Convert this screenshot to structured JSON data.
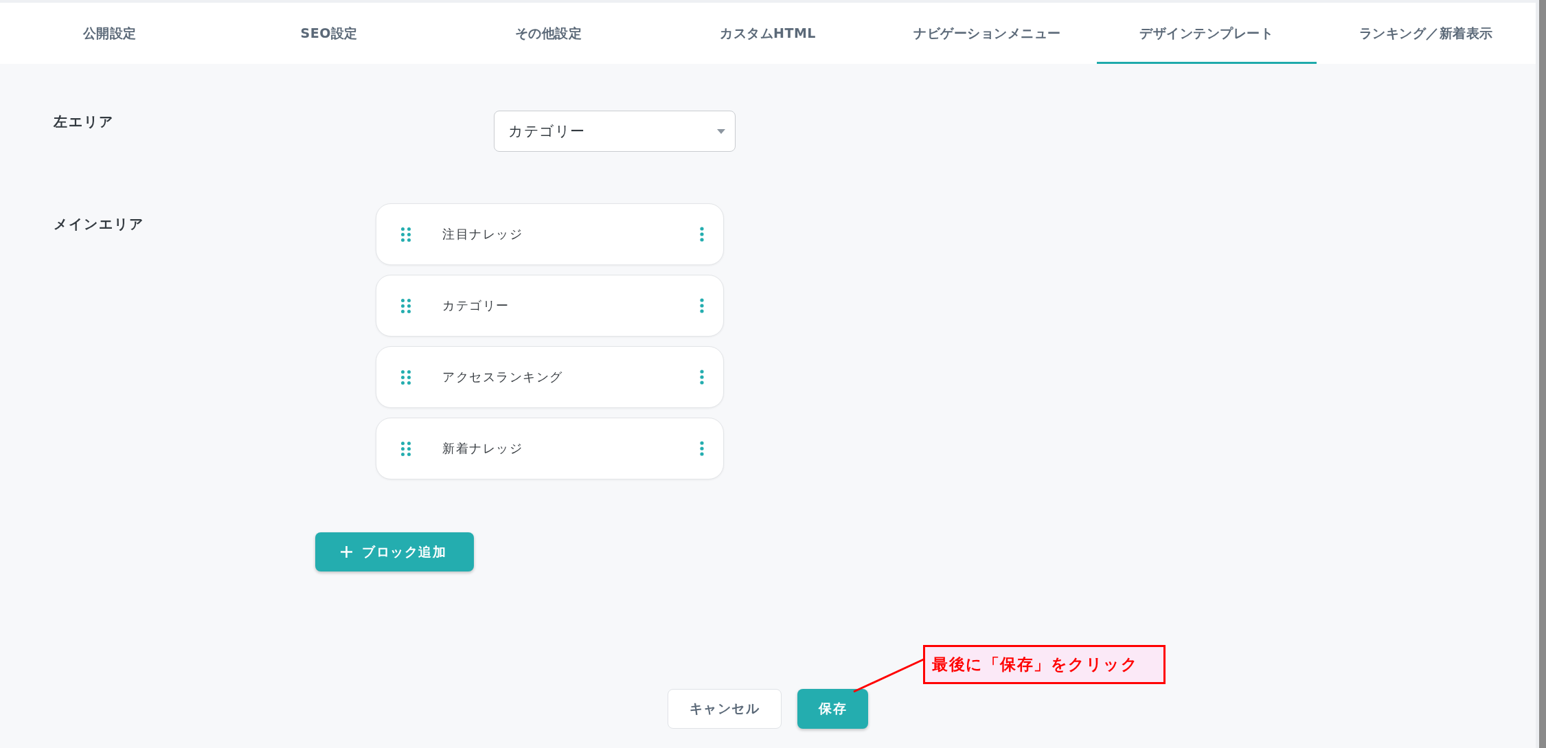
{
  "tabs": [
    {
      "label": "公開設定",
      "selected": false
    },
    {
      "label": "SEO設定",
      "selected": false
    },
    {
      "label": "その他設定",
      "selected": false
    },
    {
      "label": "カスタムHTML",
      "selected": false
    },
    {
      "label": "ナビゲーションメニュー",
      "selected": false
    },
    {
      "label": "デザインテンプレート",
      "selected": true
    },
    {
      "label": "ランキング／新着表示",
      "selected": false
    }
  ],
  "left_area": {
    "label": "左エリア",
    "select": {
      "value": "カテゴリー"
    }
  },
  "main_area": {
    "label": "メインエリア",
    "blocks": [
      {
        "title": "注目ナレッジ"
      },
      {
        "title": "カテゴリー"
      },
      {
        "title": "アクセスランキング"
      },
      {
        "title": "新着ナレッジ"
      }
    ]
  },
  "add_block_button": {
    "label": "ブロック追加"
  },
  "footer": {
    "buttons": [
      {
        "label": "キャンセル",
        "kind": "secondary"
      },
      {
        "label": "保存",
        "kind": "primary"
      }
    ]
  },
  "annotation": {
    "text": "最後に「保存」をクリック"
  }
}
